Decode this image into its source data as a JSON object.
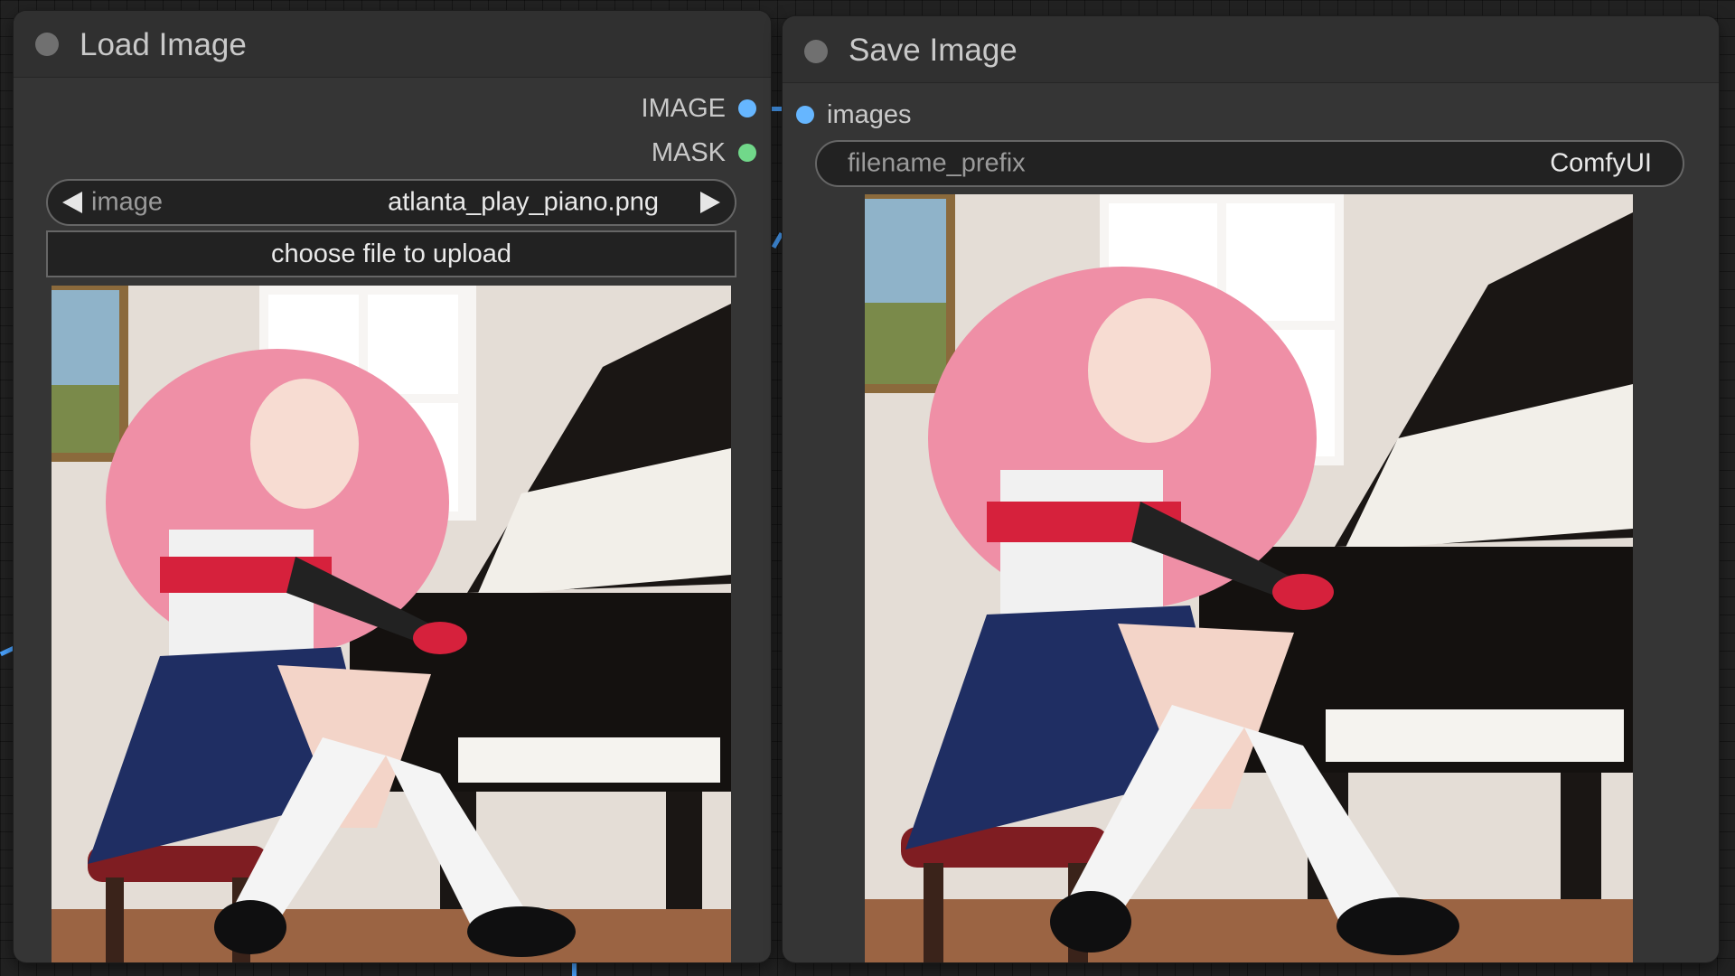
{
  "load_image_node": {
    "title": "Load Image",
    "outputs": [
      {
        "label": "IMAGE",
        "color": "#66b6ff"
      },
      {
        "label": "MASK",
        "color": "#71d88a"
      }
    ],
    "image_widget": {
      "name": "image",
      "value": "atlanta_play_piano.png"
    },
    "upload_button": "choose file to upload",
    "preview_icon": "image-preview-anime-girl-at-piano"
  },
  "save_image_node": {
    "title": "Save Image",
    "inputs": [
      {
        "label": "images",
        "color": "#66b6ff"
      }
    ],
    "filename_prefix": {
      "name": "filename_prefix",
      "value": "ComfyUI"
    },
    "preview_icon": "image-preview-anime-girl-at-piano"
  },
  "colors": {
    "canvas": "#222222",
    "node_body": "#353535",
    "node_header": "#303030",
    "link_image": "#4aa3ff"
  }
}
